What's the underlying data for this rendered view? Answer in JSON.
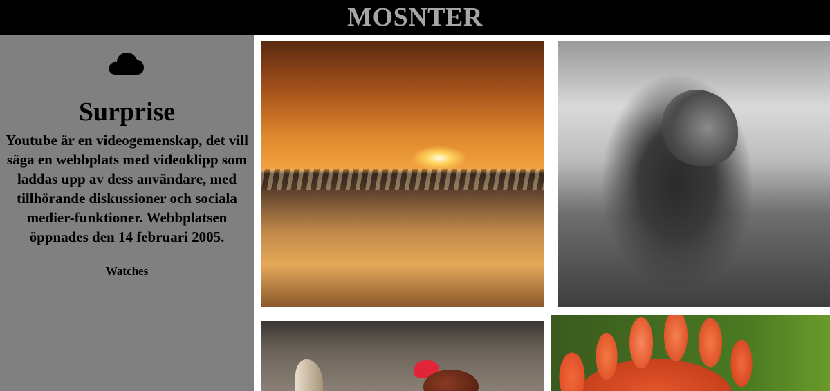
{
  "header": {
    "title": "MOSNTER"
  },
  "sidebar": {
    "icon": "cloud-icon",
    "heading": "Surprise",
    "text": "Youtube är en videogemenskap, det vill säga en webbplats med videoklipp som laddas upp av dess användare, med tillhörande diskussioner och sociala medier-funktioner. Webbplatsen öppnades den 14 februari 2005.",
    "link": "Watches"
  },
  "gallery": [
    {
      "subject": "sunset-over-sea"
    },
    {
      "subject": "lion-black-and-white"
    },
    {
      "subject": "hen"
    },
    {
      "subject": "orange-dahlia-flower"
    }
  ],
  "colors": {
    "header_bg": "#000000",
    "title": "#a6a6a6",
    "sidebar_bg": "#808080"
  }
}
